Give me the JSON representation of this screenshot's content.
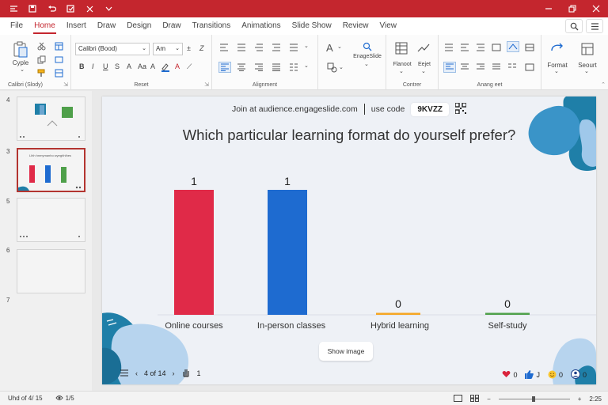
{
  "colors": {
    "brand": "#c4262e",
    "bar_red": "#e02a48",
    "bar_blue": "#1e6bd0",
    "bar_orange": "#f5a623",
    "bar_green": "#4fa04a",
    "teal": "#1f7fa8",
    "light_blue": "#b7d4ee"
  },
  "tabs": [
    "File",
    "Home",
    "Insert",
    "Draw",
    "Design",
    "Draw",
    "Transitions",
    "Animations",
    "Slide Show",
    "Review",
    "View"
  ],
  "active_tab": "Home",
  "ribbon": {
    "cyple_label": "Cyple",
    "font_name": "Calibri (Bood)",
    "font_size": "Am",
    "group_clipboard": "Calibri (Slody)",
    "group_font": "Reset",
    "group_paragraph": "Alignment",
    "engageslide_label": "EnageSlide",
    "flanoot_label": "Flanoot",
    "eejet_label": "Eejet",
    "group_contrer": "Contrer",
    "group_arrangement": "Anang eet",
    "format_label": "Format",
    "seourt_label": "Seourt"
  },
  "thumbs": {
    "numbers": [
      "4",
      "3",
      "5",
      "6",
      "7"
    ],
    "slide3_title": "Lihh hnmymanho wyeghhlhes"
  },
  "slide": {
    "join_text": "Join at audience.engageslide.com",
    "use_code": "use code",
    "code": "9KVZZ",
    "question": "Which particular learning format do yourself prefer?",
    "show_image": "Show image",
    "page_indicator": "4 of 14",
    "hands": "1",
    "hearts": "0",
    "likes": "J",
    "smiles": "0",
    "participants": "0"
  },
  "chart_data": {
    "type": "bar",
    "categories": [
      "Online courses",
      "In-person classes",
      "Hybrid learning",
      "Self-study"
    ],
    "values": [
      1,
      1,
      0,
      0
    ],
    "colors": [
      "#e02a48",
      "#1e6bd0",
      "#f5a623",
      "#4fa04a"
    ],
    "ylim": [
      0,
      1
    ],
    "grid": false
  },
  "status": {
    "slide_info": "Uhd of 4/ 15",
    "access": "1/5",
    "zoom": "2:25"
  }
}
